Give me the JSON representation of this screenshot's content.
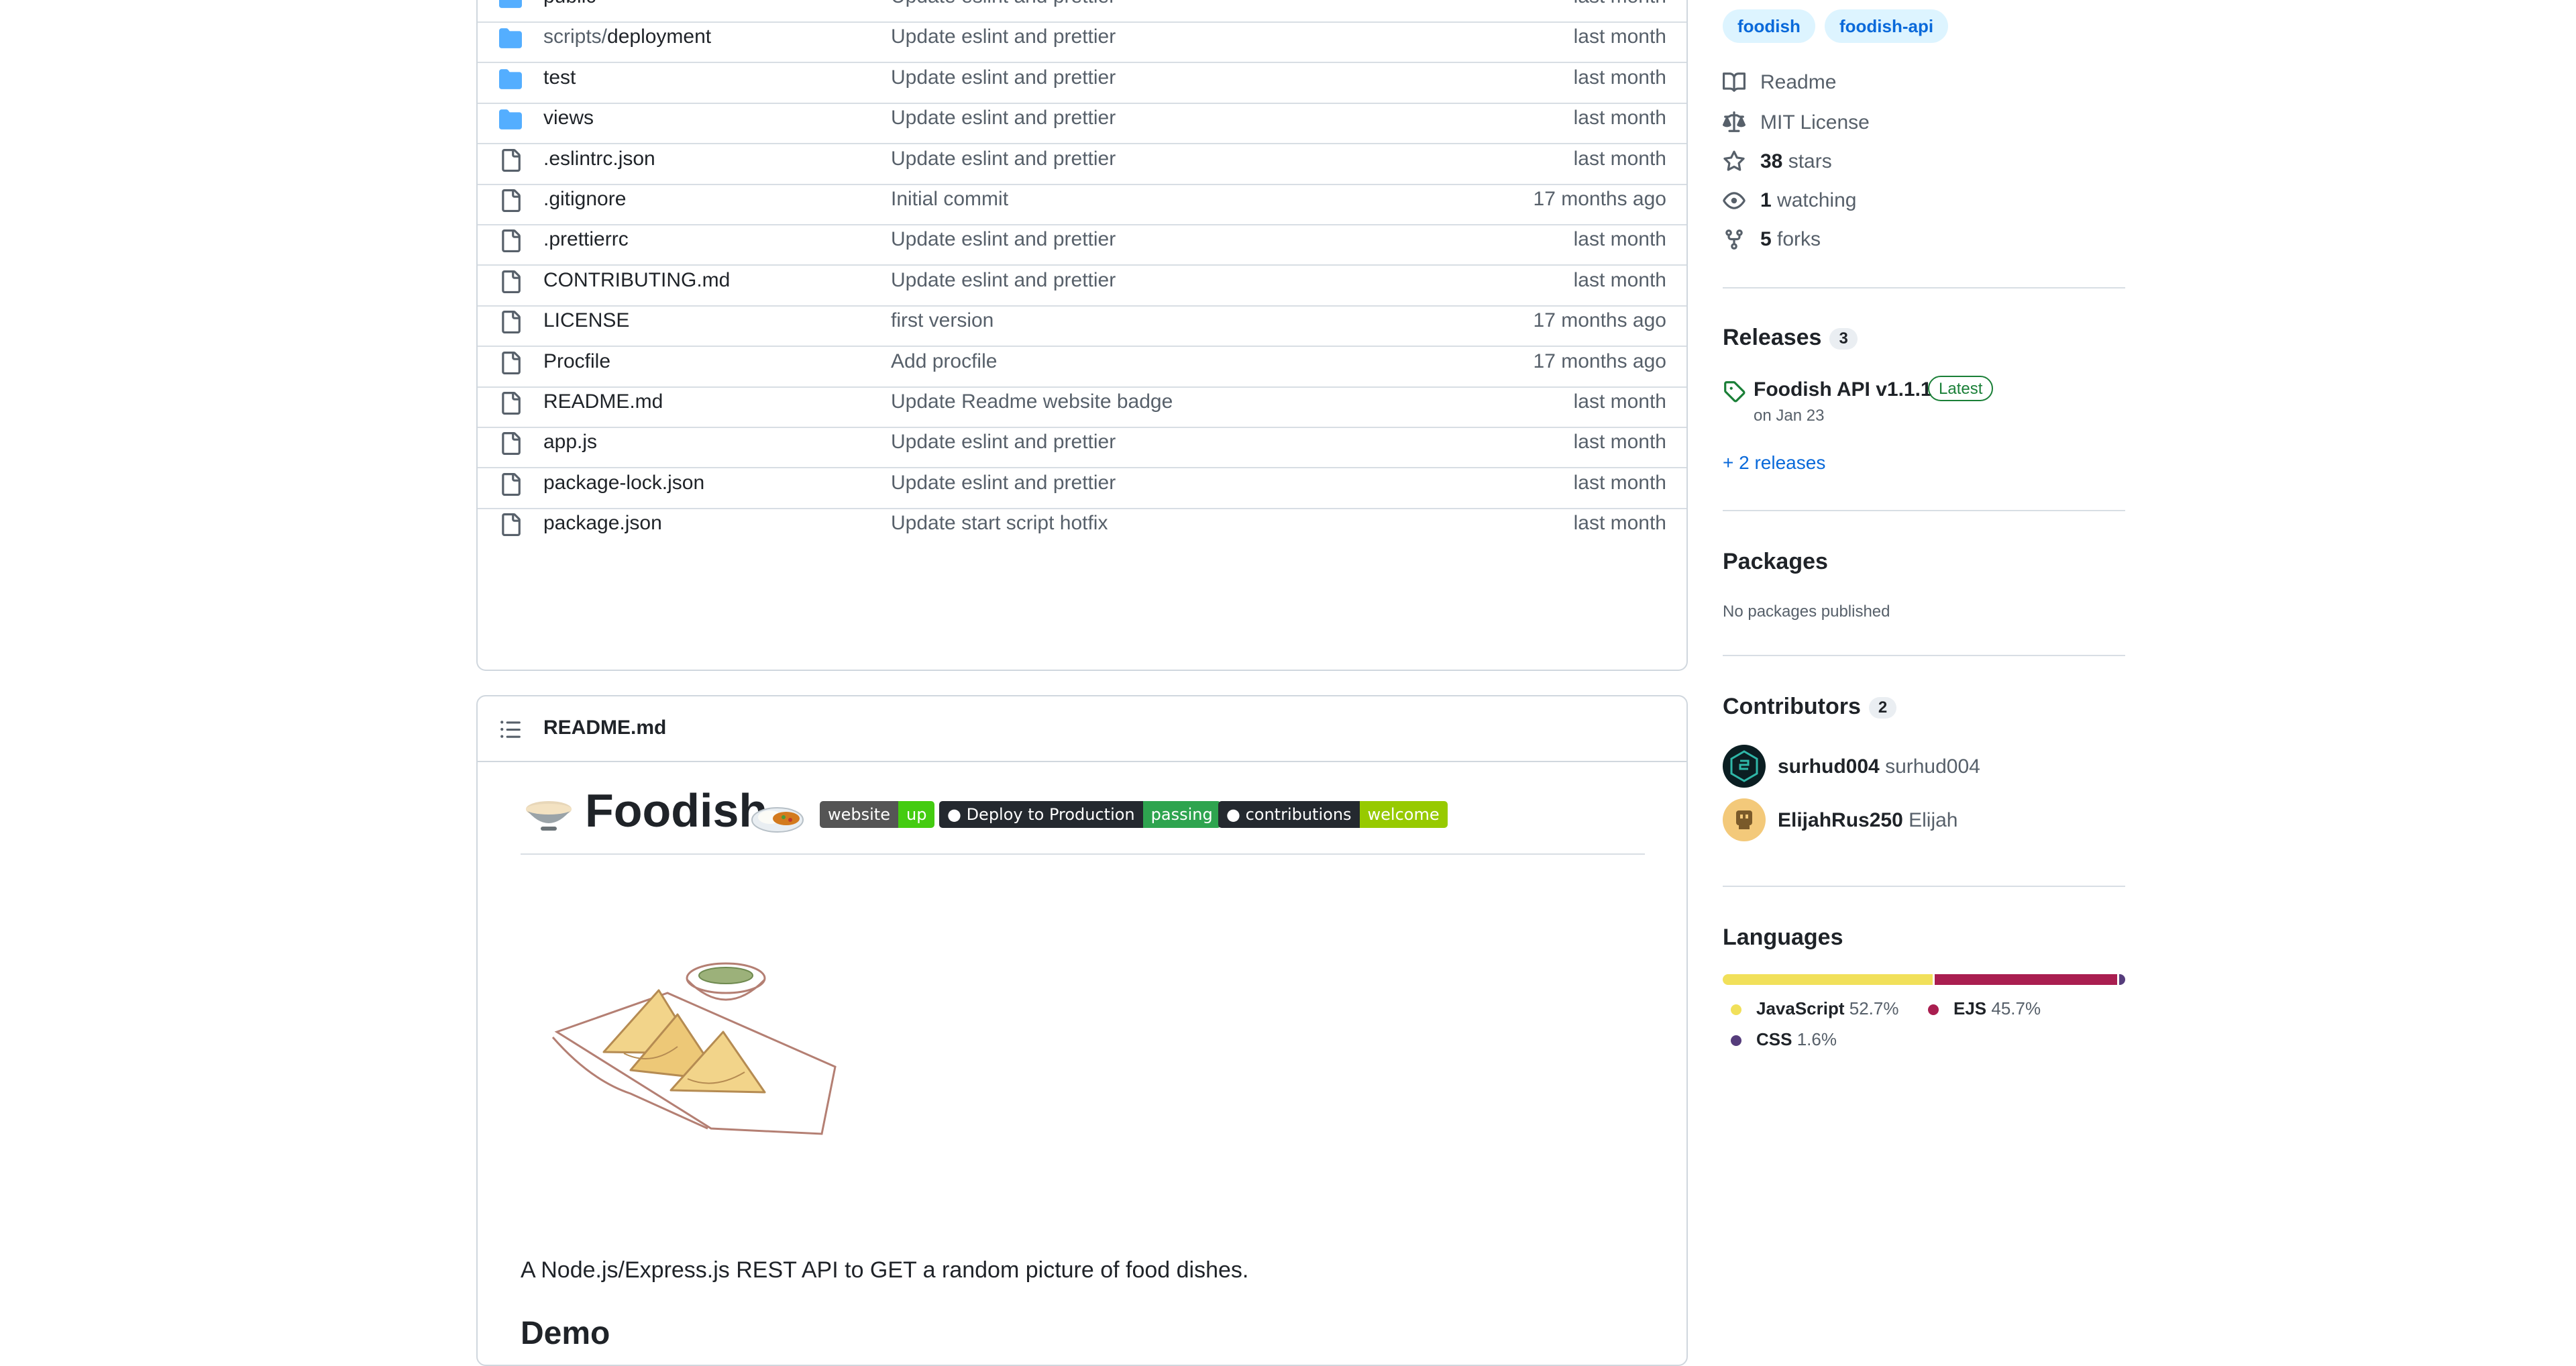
{
  "files": [
    {
      "type": "dir",
      "name": "public",
      "dir_prefix": "",
      "message": "Update eslint and prettier",
      "age": "last month"
    },
    {
      "type": "dir",
      "name": "deployment",
      "dir_prefix": "scripts/",
      "message": "Update eslint and prettier",
      "age": "last month"
    },
    {
      "type": "dir",
      "name": "test",
      "dir_prefix": "",
      "message": "Update eslint and prettier",
      "age": "last month"
    },
    {
      "type": "dir",
      "name": "views",
      "dir_prefix": "",
      "message": "Update eslint and prettier",
      "age": "last month"
    },
    {
      "type": "file",
      "name": ".eslintrc.json",
      "dir_prefix": "",
      "message": "Update eslint and prettier",
      "age": "last month"
    },
    {
      "type": "file",
      "name": ".gitignore",
      "dir_prefix": "",
      "message": "Initial commit",
      "age": "17 months ago"
    },
    {
      "type": "file",
      "name": ".prettierrc",
      "dir_prefix": "",
      "message": "Update eslint and prettier",
      "age": "last month"
    },
    {
      "type": "file",
      "name": "CONTRIBUTING.md",
      "dir_prefix": "",
      "message": "Update eslint and prettier",
      "age": "last month"
    },
    {
      "type": "file",
      "name": "LICENSE",
      "dir_prefix": "",
      "message": "first version",
      "age": "17 months ago"
    },
    {
      "type": "file",
      "name": "Procfile",
      "dir_prefix": "",
      "message": "Add procfile",
      "age": "17 months ago"
    },
    {
      "type": "file",
      "name": "README.md",
      "dir_prefix": "",
      "message": "Update Readme website badge",
      "age": "last month"
    },
    {
      "type": "file",
      "name": "app.js",
      "dir_prefix": "",
      "message": "Update eslint and prettier",
      "age": "last month"
    },
    {
      "type": "file",
      "name": "package-lock.json",
      "dir_prefix": "",
      "message": "Update eslint and prettier",
      "age": "last month"
    },
    {
      "type": "file",
      "name": "package.json",
      "dir_prefix": "",
      "message": "Update start script hotfix",
      "age": "last month"
    }
  ],
  "readme": {
    "filename": "README.md",
    "title": "Foodish",
    "badges": [
      {
        "left": "website",
        "right": "up",
        "right_color": "#4c1"
      },
      {
        "left": "Deploy to Production",
        "right": "passing",
        "right_color": "#2ea44f"
      },
      {
        "left": "contributions",
        "right": "welcome",
        "right_color": "#97ca00"
      }
    ],
    "description": "A Node.js/Express.js REST API to GET a random picture of food dishes.",
    "demo_heading": "Demo"
  },
  "sidebar": {
    "topics": [
      "foodish",
      "foodish-api"
    ],
    "readme_link": "Readme",
    "license": "MIT License",
    "stars_count": "38",
    "stars_label": "stars",
    "watching_count": "1",
    "watching_label": "watching",
    "forks_count": "5",
    "forks_label": "forks",
    "releases": {
      "heading": "Releases",
      "count": "3",
      "latest_name": "Foodish API v1.1.1",
      "latest_badge": "Latest",
      "latest_date": "on Jan 23",
      "more_link": "+ 2 releases"
    },
    "packages": {
      "heading": "Packages",
      "empty": "No packages published"
    },
    "contributors": {
      "heading": "Contributors",
      "count": "2",
      "list": [
        {
          "login": "surhud004",
          "name": "surhud004"
        },
        {
          "login": "ElijahRus250",
          "name": "Elijah"
        }
      ]
    },
    "languages": {
      "heading": "Languages",
      "items": [
        {
          "name": "JavaScript",
          "percent": "52.7%",
          "value": 52.7,
          "color": "#f1e05a"
        },
        {
          "name": "EJS",
          "percent": "45.7%",
          "value": 45.7,
          "color": "#a91e50"
        },
        {
          "name": "CSS",
          "percent": "1.6%",
          "value": 1.6,
          "color": "#563d7c"
        }
      ]
    }
  }
}
